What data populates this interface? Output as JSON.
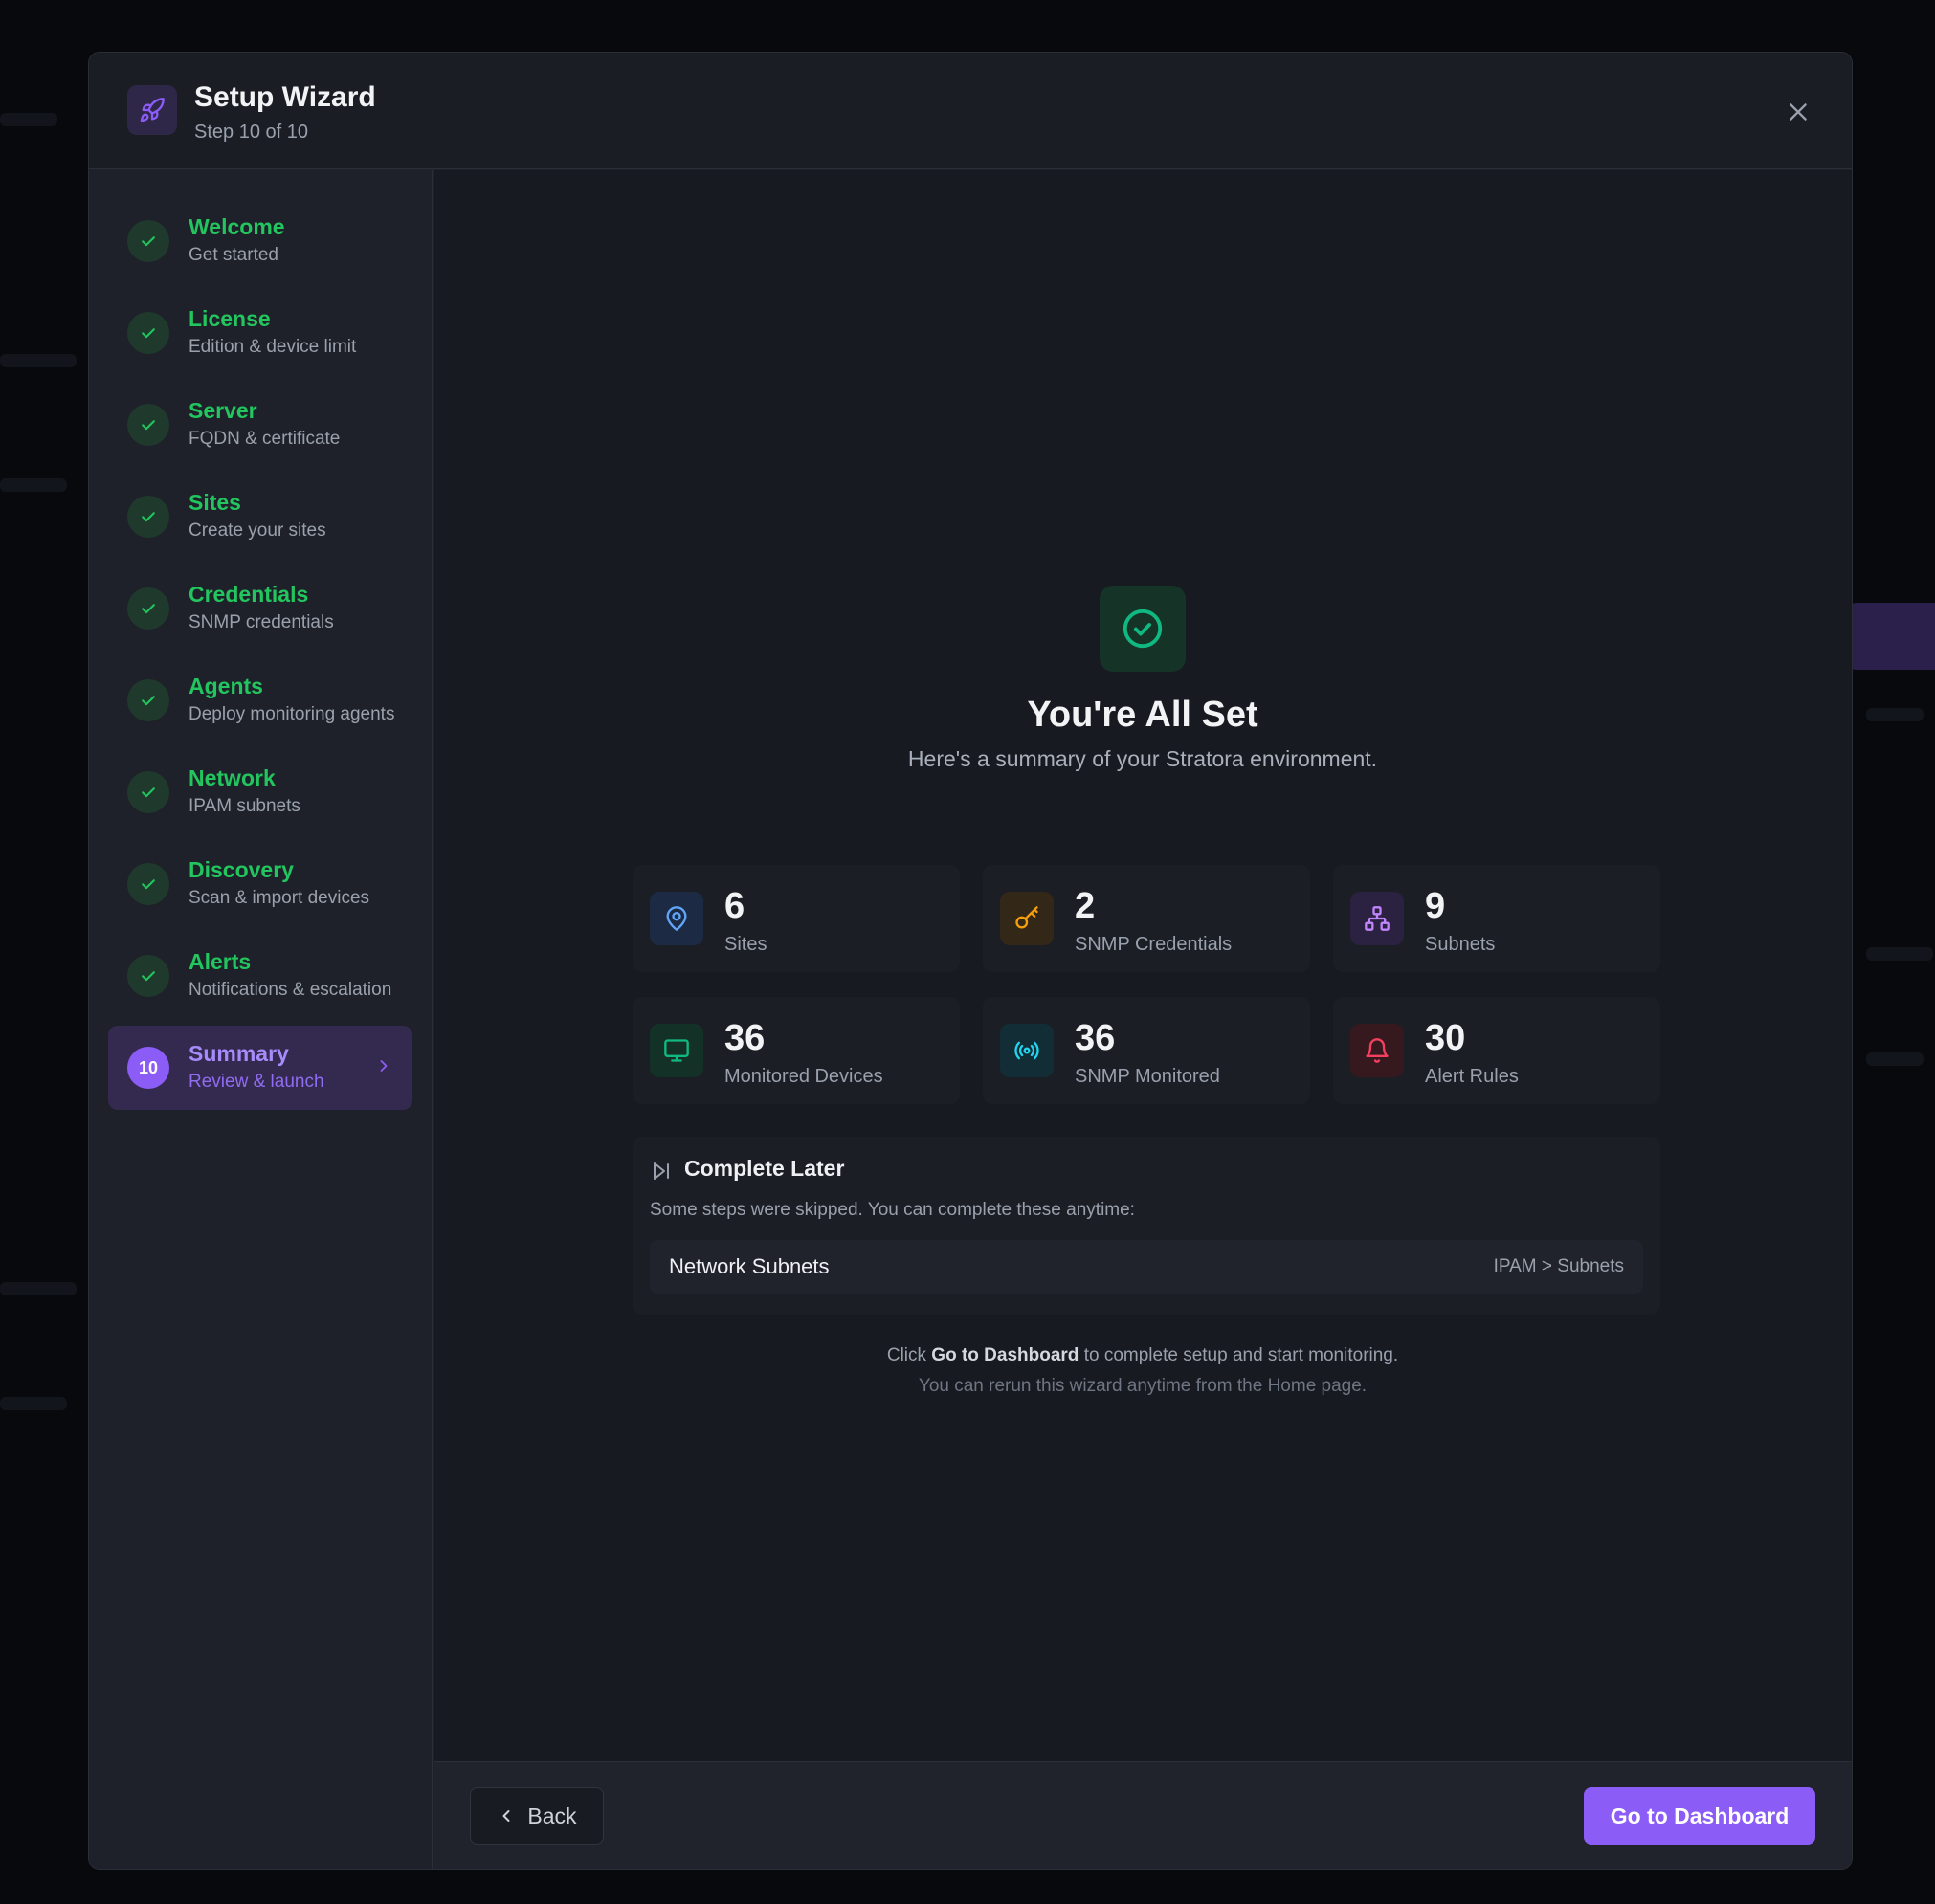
{
  "header": {
    "title": "Setup Wizard",
    "subtitle": "Step 10 of 10"
  },
  "steps": [
    {
      "name": "Welcome",
      "desc": "Get started",
      "status": "done"
    },
    {
      "name": "License",
      "desc": "Edition & device limit",
      "status": "done"
    },
    {
      "name": "Server",
      "desc": "FQDN & certificate",
      "status": "done"
    },
    {
      "name": "Sites",
      "desc": "Create your sites",
      "status": "done"
    },
    {
      "name": "Credentials",
      "desc": "SNMP credentials",
      "status": "done"
    },
    {
      "name": "Agents",
      "desc": "Deploy monitoring agents",
      "status": "done"
    },
    {
      "name": "Network",
      "desc": "IPAM subnets",
      "status": "done"
    },
    {
      "name": "Discovery",
      "desc": "Scan & import devices",
      "status": "done"
    },
    {
      "name": "Alerts",
      "desc": "Notifications & escalation",
      "status": "done"
    },
    {
      "name": "Summary",
      "desc": "Review & launch",
      "status": "active",
      "number": "10"
    }
  ],
  "main": {
    "title": "You're All Set",
    "subtitle": "Here's a summary of your Stratora environment.",
    "stats": [
      {
        "value": "6",
        "label": "Sites",
        "icon": "map-pin-icon",
        "color": "#60a5fa"
      },
      {
        "value": "2",
        "label": "SNMP Credentials",
        "icon": "key-icon",
        "color": "#f59e0b"
      },
      {
        "value": "9",
        "label": "Subnets",
        "icon": "network-icon",
        "color": "#c084fc"
      },
      {
        "value": "36",
        "label": "Monitored Devices",
        "icon": "monitor-icon",
        "color": "#10b981"
      },
      {
        "value": "36",
        "label": "SNMP Monitored",
        "icon": "radio-icon",
        "color": "#22d3ee"
      },
      {
        "value": "30",
        "label": "Alert Rules",
        "icon": "bell-icon",
        "color": "#f43f5e"
      }
    ],
    "complete_later": {
      "title": "Complete Later",
      "subtitle": "Some steps were skipped. You can complete these anytime:",
      "items": [
        {
          "name": "Network Subnets",
          "path": "IPAM > Subnets"
        }
      ]
    },
    "note_prefix": "Click ",
    "note_bold": "Go to Dashboard",
    "note_suffix": " to complete setup and start monitoring.",
    "note2": "You can rerun this wizard anytime from the Home page."
  },
  "footer": {
    "back_label": "Back",
    "primary_label": "Go to Dashboard"
  },
  "colors": {
    "accent": "#8b5cf6",
    "success": "#22c55e",
    "background": "#171a20"
  }
}
